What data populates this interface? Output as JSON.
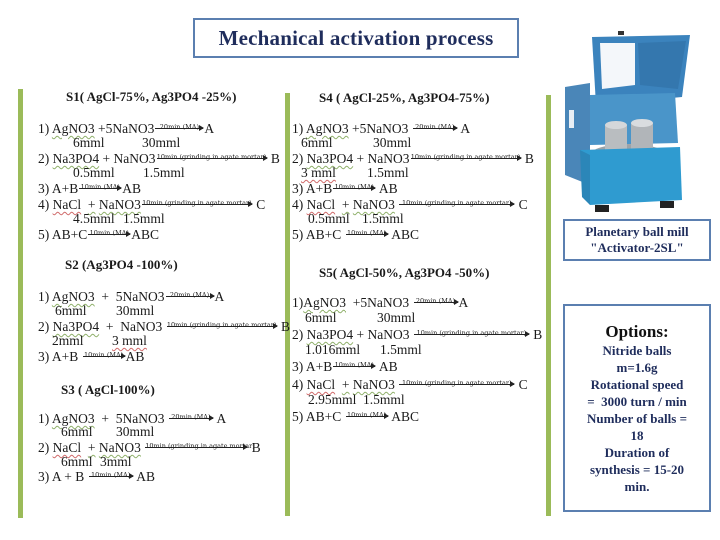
{
  "title": "Mechanical activation process",
  "sections": {
    "s1": {
      "heading": "S1( AgCl-75%, Ag3PO4 -25%)",
      "steps": [
        {
          "num": "1)",
          "lhs1": "AgNO3",
          "plus": "+",
          "lhs2": "5NaNO3",
          "cond": "20min (MA)",
          "product": "A",
          "amt1": "6mml",
          "amt2": "30mml"
        },
        {
          "num": "2)",
          "lhs1": "Na3PO4",
          "plus": "+",
          "lhs2": "NaNO3",
          "cond": "10min (grinding in agate mortar)",
          "product": "B",
          "amt1": "0.5mml",
          "amt2": "1.5mml"
        },
        {
          "num": "3)",
          "lhs1": "A+B",
          "cond": "10min (MA)",
          "product": "AB"
        },
        {
          "num": "4)",
          "lhs1": "NaCl",
          "plus": "+",
          "lhs2": "NaNO3",
          "cond": "10min (grinding in agate mortar)",
          "product": "C",
          "amt1": "4.5mml",
          "amt2": "1.5mml"
        },
        {
          "num": "5)",
          "lhs1": "AB+C",
          "cond": "10min (MA)",
          "product": "ABC"
        }
      ]
    },
    "s2": {
      "heading": "S2 (Ag3PO4 -100%)",
      "steps": [
        {
          "num": "1)",
          "lhs1": "AgNO3",
          "plus": "+",
          "lhs2": "5NaNO3",
          "cond": "20min (MA)",
          "product": "A",
          "amt1": "6mml",
          "amt2": "30mml"
        },
        {
          "num": "2)",
          "lhs1": "Na3PO4",
          "plus": "+",
          "lhs2": "NaNO3",
          "cond": "10min (grinding in agate mortar)",
          "product": "B",
          "amt1": "2mml",
          "amt2": "3 mml"
        },
        {
          "num": "3)",
          "lhs1": "A+B",
          "cond": "10min (MA)",
          "product": "AB"
        }
      ]
    },
    "s3": {
      "heading": "S3 ( AgCl-100%)",
      "steps": [
        {
          "num": "1)",
          "lhs1": "AgNO3",
          "plus": "+",
          "lhs2": "5NaNO3",
          "cond": "20min (MA)",
          "product": "A",
          "amt1": "6mml",
          "amt2": "30mml"
        },
        {
          "num": "2)",
          "lhs1": "NaCl",
          "plus": "+",
          "lhs2": "NaNO3",
          "cond": "10min (grinding in agate mortar)",
          "product": "B",
          "amt1": "6mml",
          "amt2": "3mml"
        },
        {
          "num": "3)",
          "lhs1": "A + B",
          "cond": "10min (MA)",
          "product": "AB"
        }
      ]
    },
    "s4": {
      "heading": "S4 ( AgCl-25%, Ag3PO4-75%)",
      "steps": [
        {
          "num": "1)",
          "lhs1": "AgNO3",
          "plus": "+",
          "lhs2": "5NaNO3",
          "cond": "20min (MA)",
          "product": "A",
          "amt1": "6mml",
          "amt2": "30mml"
        },
        {
          "num": "2)",
          "lhs1": "Na3PO4",
          "plus": "+",
          "lhs2": "NaNO3",
          "cond": "10min (grinding in agate mortar)",
          "product": "B",
          "amt1": "3 mml",
          "amt2": "1.5mml"
        },
        {
          "num": "3)",
          "lhs1": "A+B",
          "cond": "10min (MA)",
          "product": "AB"
        },
        {
          "num": "4)",
          "lhs1": "NaCl",
          "plus": "+",
          "lhs2": "NaNO3",
          "cond": "10min (grinding in agate mortar)",
          "product": "C",
          "amt1": "0.5mml",
          "amt2": "1.5mml"
        },
        {
          "num": "5)",
          "lhs1": "AB+C",
          "cond": "10min (MA)",
          "product": "ABC"
        }
      ]
    },
    "s5": {
      "heading": "S5( AgCl-50%, Ag3PO4 -50%)",
      "steps": [
        {
          "num": "1)",
          "lhs1": "AgNO3",
          "plus": "+",
          "lhs2": "5NaNO3",
          "cond": "20min (MA)",
          "product": "A",
          "amt1": "6mml",
          "amt2": "30mml"
        },
        {
          "num": "2)",
          "lhs1": "Na3PO4",
          "plus": "+",
          "lhs2": "NaNO3",
          "cond": "10min (grinding in agate mortar)",
          "product": "B",
          "amt1": "1.016mml",
          "amt2": "1.5mml"
        },
        {
          "num": "3)",
          "lhs1": "A+B",
          "cond": "10min (MA)",
          "product": "AB"
        },
        {
          "num": "4)",
          "lhs1": "NaCl",
          "plus": "+",
          "lhs2": "NaNO3",
          "cond": "10min (grinding in agate mortar)",
          "product": "C",
          "amt1": "2.95mml",
          "amt2": "1.5mml"
        },
        {
          "num": "5)",
          "lhs1": "AB+C",
          "cond": "10min (MA)",
          "product": "ABC"
        }
      ]
    }
  },
  "equipment": {
    "photo_alt": "planetary-ball-mill-photo",
    "caption_line1": "Planetary ball mill",
    "caption_line2": "\"Activator-2SL\""
  },
  "options": {
    "heading": "Options:",
    "lines": [
      "Nitride balls",
      "m=1.6g",
      "Rotational speed",
      "=  3000 turn / min",
      "Number of balls =",
      "18",
      "Duration of",
      "synthesis = 15-20",
      "min."
    ]
  },
  "colors": {
    "accent_border": "#5b7fb0",
    "title_text": "#1f2d5c",
    "divider_green": "#9bbb59",
    "machine_blue": "#3f8fc4"
  }
}
